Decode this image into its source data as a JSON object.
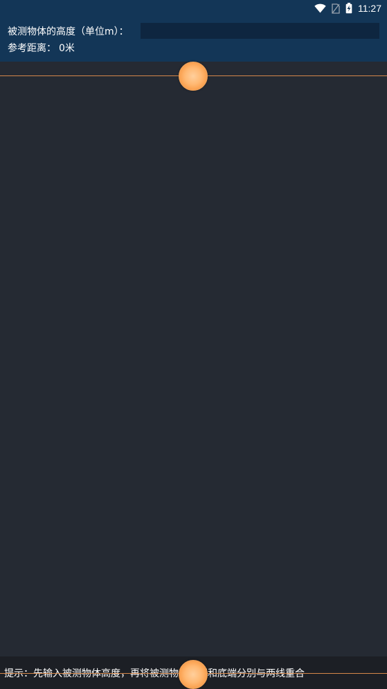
{
  "status_bar": {
    "time": "11:27",
    "icons": [
      "wifi-icon",
      "no-sim-icon",
      "battery-charging-icon"
    ]
  },
  "header": {
    "height_label": "被测物体的高度（单位m）：",
    "height_input_value": "",
    "distance_label": "参考距离：",
    "distance_value": "0米"
  },
  "hint": {
    "text": "提示：先输入被测物体高度，再将被测物体顶端和底端分别与两线重合"
  },
  "colors": {
    "header_bg": "#133657",
    "main_bg": "#252a33",
    "line": "#d5874a",
    "handle": "#ffb872",
    "hint_bg": "#1c1f25"
  }
}
